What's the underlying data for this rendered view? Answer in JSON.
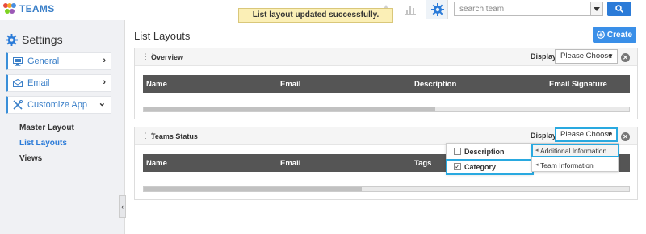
{
  "app": {
    "name": "TEAMS"
  },
  "toast": {
    "message": "List layout updated successfully."
  },
  "search": {
    "placeholder": "search team"
  },
  "colors": {
    "accent": "#2b7bd8",
    "highlight": "#29a9e0",
    "grid_header": "#555555",
    "toast_bg": "#fbefb6"
  },
  "sidebar": {
    "title": "Settings",
    "items": [
      {
        "label": "General",
        "icon": "monitor-icon",
        "chevron": "›"
      },
      {
        "label": "Email",
        "icon": "envelope-icon",
        "chevron": "›"
      },
      {
        "label": "Customize App",
        "icon": "tools-icon",
        "chevron": "⌄"
      }
    ],
    "subitems": [
      {
        "label": "Master Layout",
        "active": false
      },
      {
        "label": "List Layouts",
        "active": true
      },
      {
        "label": "Views",
        "active": false
      }
    ]
  },
  "main": {
    "title": "List Layouts",
    "create_label": "Create",
    "panels": [
      {
        "title": "Overview",
        "display_label": "Display",
        "choose_label": "Please Choose",
        "columns": [
          "Name",
          "Email",
          "Description",
          "Email Signature"
        ],
        "scroll_progress": 0.6
      },
      {
        "title": "Teams Status",
        "display_label": "Display",
        "choose_label": "Please Choose",
        "columns": [
          "Name",
          "Email",
          "Tags"
        ],
        "scroll_progress": 0.45
      }
    ]
  },
  "column_menu": [
    {
      "label": "Description",
      "checked": false
    },
    {
      "label": "Category",
      "checked": true
    }
  ],
  "display_menu": [
    {
      "label": "Additional Information",
      "highlighted": true
    },
    {
      "label": "Team Information",
      "highlighted": false
    }
  ]
}
